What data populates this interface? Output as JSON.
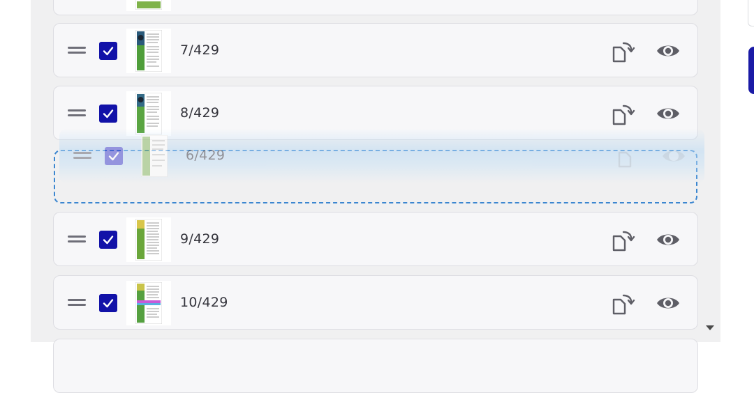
{
  "pages": [
    {
      "label": "7/429",
      "checked": true,
      "thumb_accent": "#1f8a2a"
    },
    {
      "label": "8/429",
      "checked": true,
      "thumb_accent": "#3f9c32"
    },
    {
      "label": "9/429",
      "checked": true,
      "thumb_accent": "#6aa63a"
    },
    {
      "label": "10/429",
      "checked": true,
      "thumb_accent": "#55a040"
    }
  ],
  "dragging": {
    "label": "6/429",
    "checked": true
  },
  "icons": {
    "handle": "drag-handle-icon",
    "rotate": "rotate-page-icon",
    "preview": "eye-icon",
    "check": "checkmark-icon"
  },
  "colors": {
    "checkbox": "#1212a8",
    "drop_border": "#3b86d0",
    "row_bg": "#f7f7f9",
    "panel_bg": "#f0f0f1",
    "accent_button": "#1a1aa6"
  }
}
